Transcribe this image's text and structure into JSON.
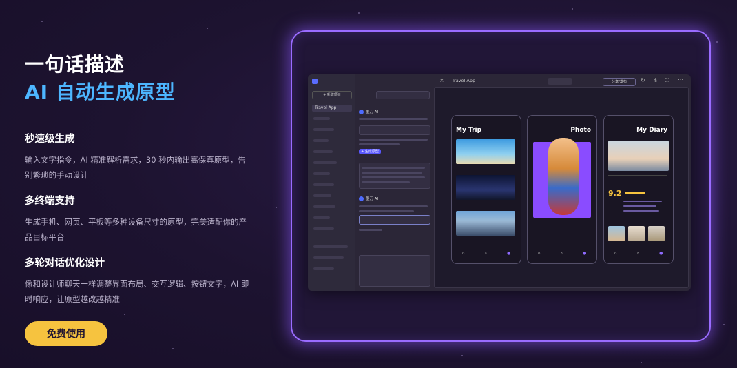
{
  "hero": {
    "line1": "一句话描述",
    "line2": "AI 自动生成原型"
  },
  "features": [
    {
      "title": "秒速级生成",
      "desc": "输入文字指令，AI 精准解析需求，30 秒内输出高保真原型，告别繁琐的手动设计"
    },
    {
      "title": "多终端支持",
      "desc": "生成手机、网页、平板等多种设备尺寸的原型，完美适配你的产品目标平台"
    },
    {
      "title": "多轮对话优化设计",
      "desc": "像和设计师聊天一样调整界面布局、交互逻辑、按钮文字，AI 即时响应，让原型越改越精准"
    }
  ],
  "cta": {
    "label": "免费使用"
  },
  "colors": {
    "accent_blue": "#4db6ff",
    "cta_yellow": "#f6c33f",
    "frame_glow": "#9a6cff",
    "background": "#1d1330"
  },
  "showcase": {
    "sidebar": {
      "new_button": "+ 新建项目",
      "active_item": "Travel App"
    },
    "chat": {
      "ai_name": "墨刀 AI",
      "primary_button": "+ 生成原型"
    },
    "toolbar": {
      "title": "Travel App",
      "publish": "分享/发布"
    },
    "screens": [
      {
        "title": "My Trip"
      },
      {
        "title": "Photo"
      },
      {
        "title": "My Diary",
        "rating": "9.2"
      }
    ]
  }
}
